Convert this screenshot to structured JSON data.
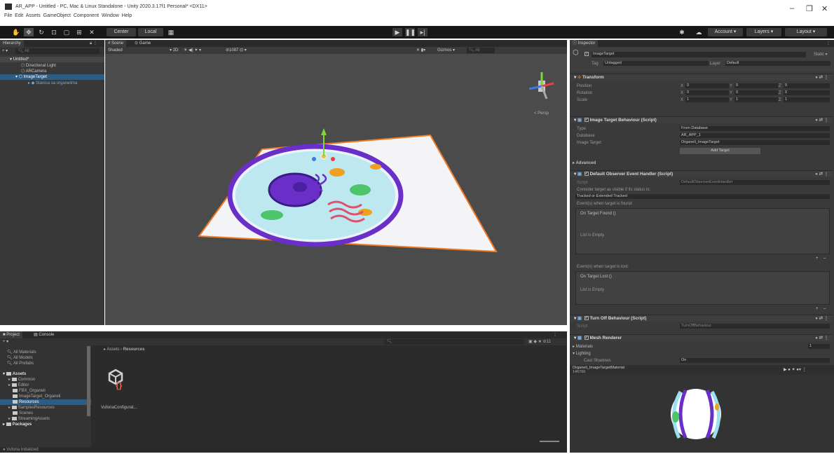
{
  "window": {
    "title": "AR_APP - Untitled - PC, Mac & Linux Standalone - Unity 2020.3.17f1 Personal* <DX11>",
    "menu": [
      "File",
      "Edit",
      "Assets",
      "GameObject",
      "Component",
      "Window",
      "Help"
    ],
    "controls": {
      "minimize": "–",
      "maximize": "❐",
      "close": "✕"
    }
  },
  "toolbar": {
    "pivot": "Center",
    "space": "Local",
    "account": "Account",
    "layers": "Layers",
    "layout": "Layout"
  },
  "hierarchy": {
    "tab": "Hierarchy",
    "search_placeholder": "All",
    "scene": "Untitled*",
    "items": [
      "Directional Light",
      "ARCamera",
      "ImageTarget",
      "Stanica sa organelima"
    ]
  },
  "scene_view": {
    "tab_scene": "Scene",
    "tab_game": "Game",
    "shading": "Shaded",
    "mode_2d": "2D",
    "gizmos": "Gizmos",
    "search_placeholder": "All",
    "persp": "< Persp",
    "counter": "1087"
  },
  "project": {
    "tab_project": "Project",
    "tab_console": "Console",
    "favorites": [
      "All Materials",
      "All Models",
      "All Prefabs"
    ],
    "assets_root": "Assets",
    "folders": [
      "Common",
      "Editor",
      "FBX_Organeli",
      "ImageTarget_Organeli",
      "Resources",
      "SamplesResources",
      "Scenes",
      "StreamingAssets"
    ],
    "packages": "Packages",
    "breadcrumb": [
      "Assets",
      "Resources"
    ],
    "file_label": "VuforiaConfigurat...",
    "status": "Vuforia Initialized",
    "count": "11"
  },
  "inspector": {
    "tab": "Inspector",
    "object_name": "ImageTarget",
    "static_label": "Static",
    "tag_label": "Tag",
    "tag_value": "Untagged",
    "layer_label": "Layer",
    "layer_value": "Default",
    "transform": {
      "title": "Transform",
      "rows": [
        {
          "label": "Position",
          "x": "0",
          "y": "0",
          "z": "0"
        },
        {
          "label": "Rotation",
          "x": "0",
          "y": "0",
          "z": "0"
        },
        {
          "label": "Scale",
          "x": "1",
          "y": "1",
          "z": "1"
        }
      ]
    },
    "image_target": {
      "title": "Image Target Behaviour (Script)",
      "type_label": "Type",
      "type_value": "From Database",
      "database_label": "Database",
      "database_value": "AR_APP_1",
      "target_label": "Image Target",
      "target_value": "Organeli_ImageTarget",
      "add_button": "Add Target",
      "advanced": "Advanced"
    },
    "observer": {
      "title": "Default Observer Event Handler (Script)",
      "script_label": "Script",
      "script_value": "DefaultObserverEventHandler",
      "consider_label": "Consider target as visible if its status is:",
      "status_value": "Tracked or Extended Tracked",
      "found_label": "Event(s) when target is found:",
      "found_event": "On Target Found ()",
      "found_list": "List is Empty",
      "lost_label": "Event(s) when target is lost:",
      "lost_event": "On Target Lost ()",
      "lost_list": "List is Empty",
      "plus": "+",
      "minus": "–"
    },
    "turnoff": {
      "title": "Turn Off Behaviour (Script)",
      "script_label": "Script",
      "script_value": "TurnOffBehaviour"
    },
    "mesh": {
      "title": "Mesh Renderer",
      "materials_label": "Materials",
      "materials_count": "1",
      "lighting_label": "Lighting",
      "cast_shadows_label": "Cast Shadows",
      "cast_shadows_value": "On"
    },
    "material_preview": {
      "name": "Organeli_ImageTargetMaterial",
      "sub": "146766"
    }
  },
  "colors": {
    "editor_dark": "#383838",
    "toolbar": "#171717",
    "selection": "#2c5d87",
    "target_outline": "#f07a2a",
    "cell_outline": "#6a2fc9"
  }
}
